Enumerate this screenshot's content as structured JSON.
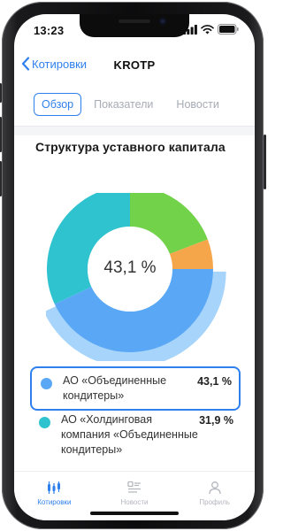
{
  "status_bar": {
    "time": "13:23"
  },
  "nav": {
    "back_label": "Котировки",
    "title": "KROTP"
  },
  "tabs": [
    {
      "label": "Обзор",
      "active": true
    },
    {
      "label": "Показатели",
      "active": false
    },
    {
      "label": "Новости",
      "active": false
    }
  ],
  "section": {
    "title": "Структура уставного капитала"
  },
  "chart_data": {
    "type": "pie",
    "center_label": "43,1 %",
    "selected_index": 0,
    "slices": [
      {
        "label": "АО «Объединенные кондитеры»",
        "value": 43.1,
        "value_text": "43,1 %",
        "color": "#5aa8f5"
      },
      {
        "label": "АО «Холдинговая компания «Объединенные кондитеры»",
        "value": 31.9,
        "value_text": "31,9 %",
        "color": "#2fc3cf"
      },
      {
        "label": "",
        "value": 19.2,
        "color": "#72d24a"
      },
      {
        "label": "",
        "value": 5.8,
        "color": "#f6a64a"
      }
    ]
  },
  "legend": [
    {
      "name": "АО «Объединенные кондитеры»",
      "pct": "43,1 %",
      "color": "#5aa8f5",
      "selected": true
    },
    {
      "name": "АО «Холдинговая компания «Объединенные кондитеры»",
      "pct": "31,9 %",
      "color": "#2fc3cf",
      "selected": false
    }
  ],
  "tabbar": [
    {
      "label": "Котировки",
      "icon": "quotes-icon",
      "active": true
    },
    {
      "label": "Новости",
      "icon": "news-icon",
      "active": false
    },
    {
      "label": "Профиль",
      "icon": "profile-icon",
      "active": false
    }
  ],
  "colors": {
    "accent": "#2f80ed",
    "inactive": "#a7abb4"
  }
}
